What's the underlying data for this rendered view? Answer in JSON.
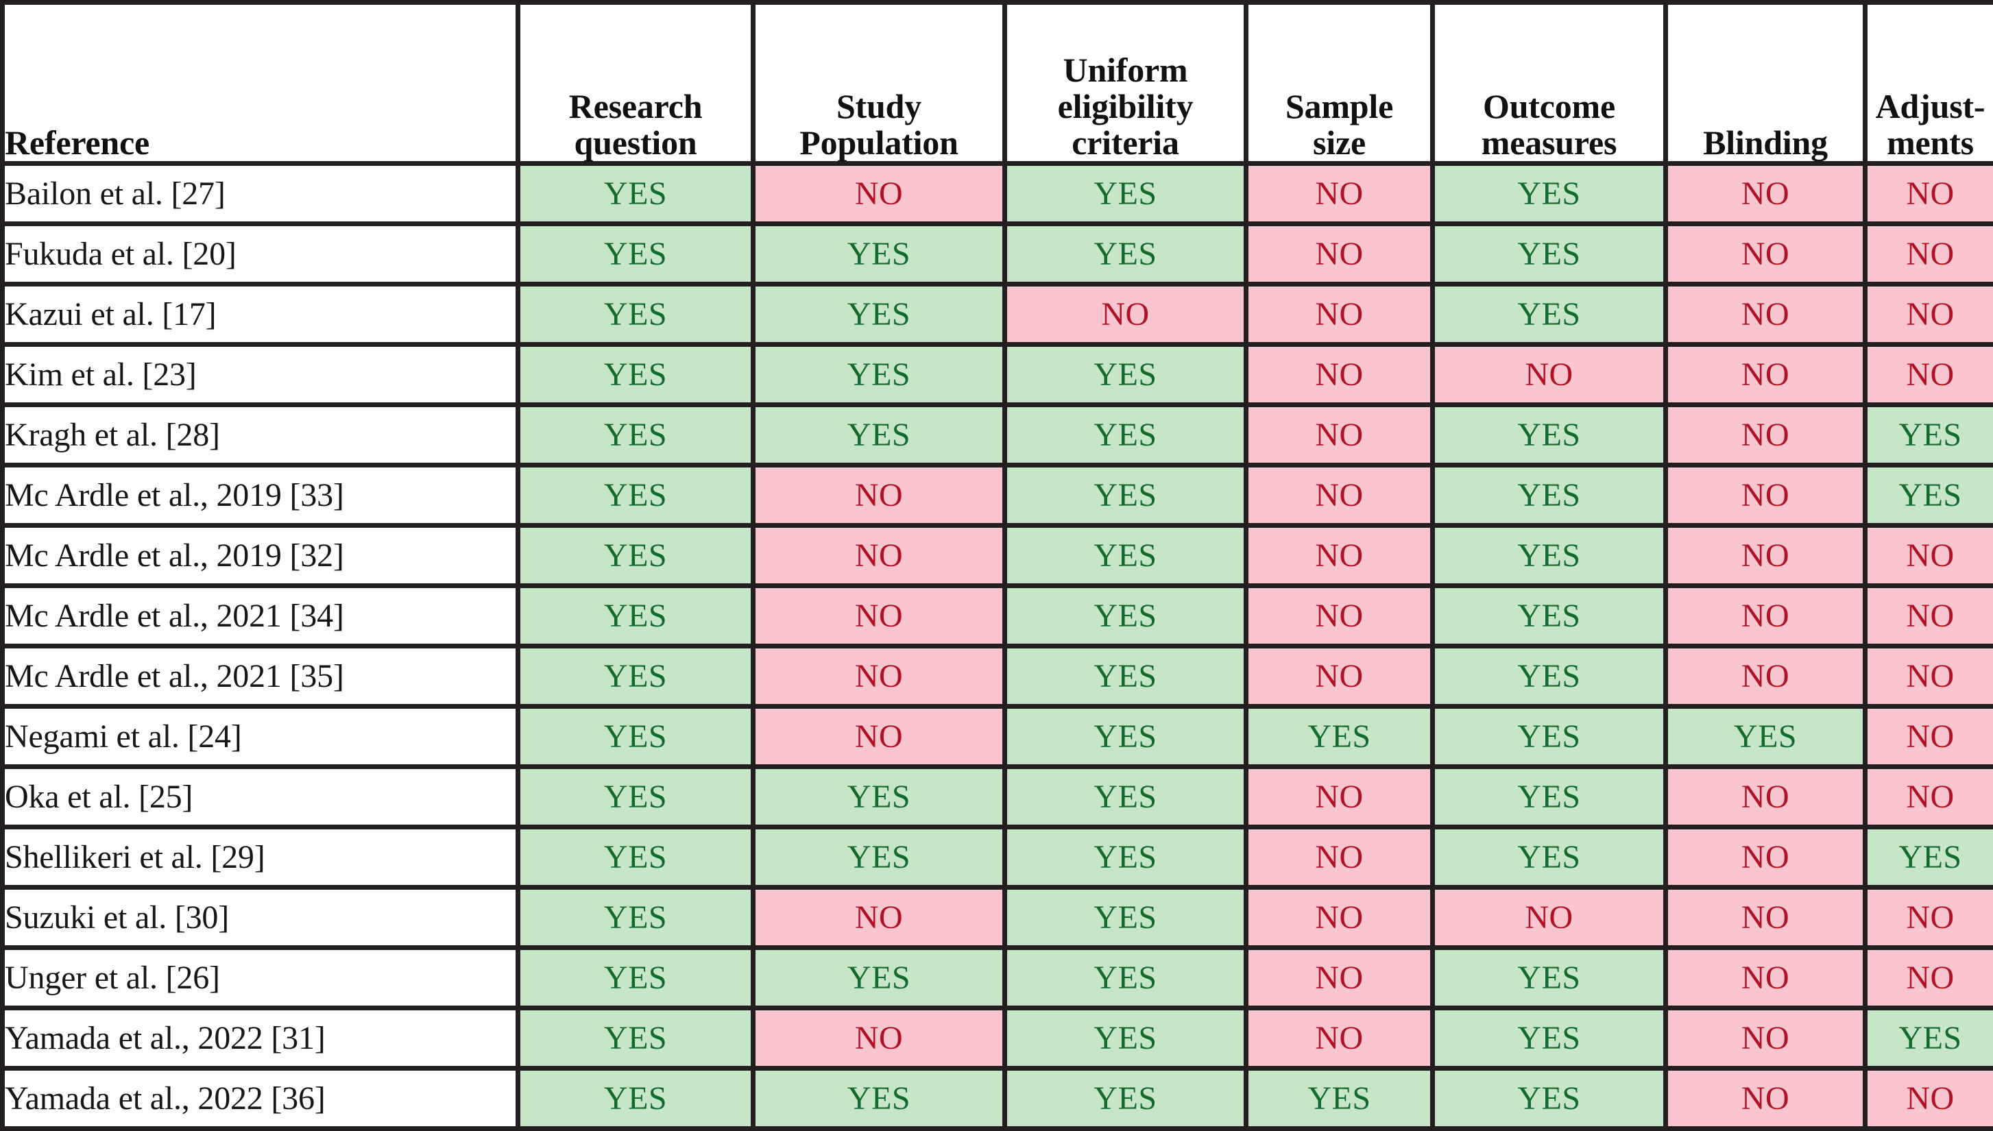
{
  "table": {
    "name": "study-quality-assessment-table",
    "columns": [
      {
        "key": "reference",
        "label": "Reference",
        "align": "left"
      },
      {
        "key": "research_question",
        "label": "Research\nquestion",
        "align": "center"
      },
      {
        "key": "study_population",
        "label": "Study\nPopulation",
        "align": "center"
      },
      {
        "key": "uniform_eligibility_criteria",
        "label": "Uniform\neligibility\ncriteria",
        "align": "center"
      },
      {
        "key": "sample_size",
        "label": "Sample\nsize",
        "align": "center"
      },
      {
        "key": "outcome_measures",
        "label": "Outcome\nmeasures",
        "align": "center"
      },
      {
        "key": "blinding",
        "label": "Blinding",
        "align": "center"
      },
      {
        "key": "adjustments",
        "label": "Adjust-\nments",
        "align": "center"
      }
    ],
    "value_labels": {
      "yes": "YES",
      "no": "NO"
    },
    "colors": {
      "yes_background": "#c7e6c8",
      "yes_text": "#136b2e",
      "no_background": "#f9c6cf",
      "no_text": "#b01223",
      "border": "#231f20",
      "cell_background": "#ffffff",
      "header_text": "#111111"
    },
    "rows": [
      {
        "reference": "Bailon et al. [27]",
        "values": [
          "YES",
          "NO",
          "YES",
          "NO",
          "YES",
          "NO",
          "NO"
        ]
      },
      {
        "reference": "Fukuda et al. [20]",
        "values": [
          "YES",
          "YES",
          "YES",
          "NO",
          "YES",
          "NO",
          "NO"
        ]
      },
      {
        "reference": "Kazui et al. [17]",
        "values": [
          "YES",
          "YES",
          "NO",
          "NO",
          "YES",
          "NO",
          "NO"
        ]
      },
      {
        "reference": "Kim et al. [23]",
        "values": [
          "YES",
          "YES",
          "YES",
          "NO",
          "NO",
          "NO",
          "NO"
        ]
      },
      {
        "reference": "Kragh et al. [28]",
        "values": [
          "YES",
          "YES",
          "YES",
          "NO",
          "YES",
          "NO",
          "YES"
        ]
      },
      {
        "reference": "Mc Ardle et al., 2019 [33]",
        "values": [
          "YES",
          "NO",
          "YES",
          "NO",
          "YES",
          "NO",
          "YES"
        ]
      },
      {
        "reference": "Mc Ardle et al., 2019 [32]",
        "values": [
          "YES",
          "NO",
          "YES",
          "NO",
          "YES",
          "NO",
          "NO"
        ]
      },
      {
        "reference": "Mc Ardle et al., 2021 [34]",
        "values": [
          "YES",
          "NO",
          "YES",
          "NO",
          "YES",
          "NO",
          "NO"
        ]
      },
      {
        "reference": "Mc Ardle et al., 2021 [35]",
        "values": [
          "YES",
          "NO",
          "YES",
          "NO",
          "YES",
          "NO",
          "NO"
        ]
      },
      {
        "reference": "Negami et al. [24]",
        "values": [
          "YES",
          "NO",
          "YES",
          "YES",
          "YES",
          "YES",
          "NO"
        ]
      },
      {
        "reference": "Oka et al. [25]",
        "values": [
          "YES",
          "YES",
          "YES",
          "NO",
          "YES",
          "NO",
          "NO"
        ]
      },
      {
        "reference": "Shellikeri et al. [29]",
        "values": [
          "YES",
          "YES",
          "YES",
          "NO",
          "YES",
          "NO",
          "YES"
        ]
      },
      {
        "reference": "Suzuki et al. [30]",
        "values": [
          "YES",
          "NO",
          "YES",
          "NO",
          "NO",
          "NO",
          "NO"
        ]
      },
      {
        "reference": "Unger et al. [26]",
        "values": [
          "YES",
          "YES",
          "YES",
          "NO",
          "YES",
          "NO",
          "NO"
        ]
      },
      {
        "reference": "Yamada et al., 2022 [31]",
        "values": [
          "YES",
          "NO",
          "YES",
          "NO",
          "YES",
          "NO",
          "YES"
        ]
      },
      {
        "reference": "Yamada et al., 2022 [36]",
        "values": [
          "YES",
          "YES",
          "YES",
          "YES",
          "YES",
          "NO",
          "NO"
        ]
      }
    ]
  }
}
